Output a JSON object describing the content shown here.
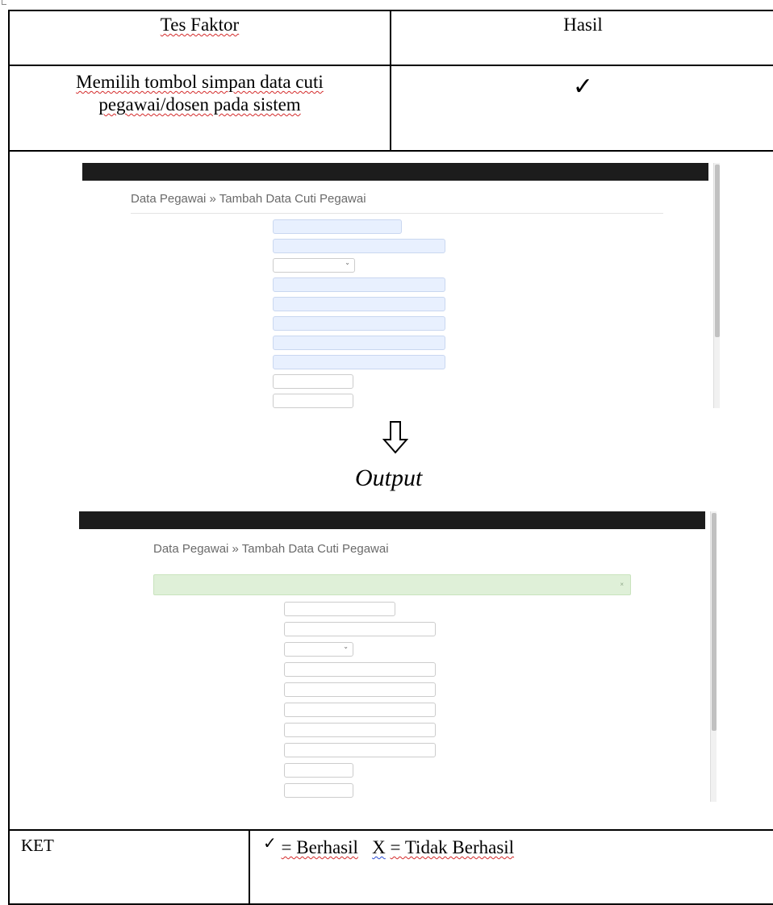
{
  "table": {
    "header": {
      "col1": "Tes Faktor",
      "col2": "Hasil"
    },
    "step": {
      "line1": "Memilih tombol simpan data cuti",
      "line2": "pegawai/dosen pada sistem",
      "result_icon": "check-mark",
      "result_glyph": "✓"
    },
    "screenshot_before": {
      "navbar": [
        "",
        "",
        "",
        ""
      ],
      "heading": "Data Pegawai » Tambah Data Cuti Pegawai",
      "fields": [
        {
          "label": "",
          "value": ""
        },
        {
          "label": "",
          "value": ""
        },
        {
          "label": "",
          "value": ""
        },
        {
          "label": "",
          "value": ""
        },
        {
          "label": "",
          "value": ""
        },
        {
          "label": "",
          "value": ""
        },
        {
          "label": "",
          "value": ""
        },
        {
          "label": "",
          "value": ""
        },
        {
          "label": "",
          "value": ""
        },
        {
          "label": "",
          "value": ""
        }
      ]
    },
    "arrow_icon": "outline-down-arrow-icon",
    "output_label": "Output",
    "screenshot_after": {
      "navbar": [
        "",
        "",
        "",
        ""
      ],
      "heading": "Data Pegawai » Tambah Data Cuti Pegawai",
      "alert": "",
      "alert_close": "×",
      "fields": [
        {
          "label": "",
          "placeholder": ""
        },
        {
          "label": "",
          "placeholder": ""
        },
        {
          "label": "",
          "placeholder": ""
        },
        {
          "label": "",
          "placeholder": ""
        },
        {
          "label": "",
          "placeholder": ""
        },
        {
          "label": "",
          "placeholder": ""
        },
        {
          "label": "",
          "placeholder": ""
        },
        {
          "label": "",
          "placeholder": ""
        },
        {
          "label": "",
          "placeholder": ""
        },
        {
          "label": "",
          "placeholder": ""
        }
      ]
    },
    "ket": {
      "label": "KET",
      "check_glyph": "✓",
      "success_text": "= Berhasil",
      "fail_symbol": "X",
      "fail_text": "= Tidak Berhasil"
    }
  }
}
